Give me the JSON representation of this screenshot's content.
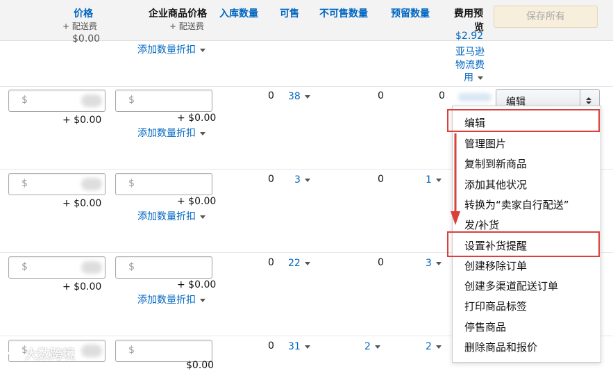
{
  "header": {
    "price_label": "价格",
    "price_sub": "+ 配送费",
    "business_price_label": "企业商品价格",
    "business_price_sub": "+ 配送费",
    "inbound_label": "入库数量",
    "available_label": "可售",
    "unsellable_label": "不可售数量",
    "reserved_label": "预留数量",
    "fee_preview_line1": "费用预",
    "fee_preview_line2": "览",
    "save_all": "保存所有"
  },
  "top_partial": {
    "partial_price": "$0.00",
    "add_discount": "添加数量折扣",
    "fee_line0": "$2.92",
    "fee_line1": "亚马逊",
    "fee_line2": "物流费",
    "fee_line3": "用"
  },
  "rows": [
    {
      "price_prefix": "$",
      "price_plus": "+ $0.00",
      "business_prefix": "$",
      "business_plus": "+ $0.00",
      "add_discount": "添加数量折扣",
      "inbound": "0",
      "available": "38",
      "unsellable": "0",
      "reserved": "0"
    },
    {
      "price_prefix": "$",
      "price_plus": "+ $0.00",
      "business_prefix": "$",
      "business_plus": "+ $0.00",
      "add_discount": "添加数量折扣",
      "inbound": "0",
      "available": "3",
      "unsellable": "0",
      "reserved": "1"
    },
    {
      "price_prefix": "$",
      "price_plus": "+ $0.00",
      "business_prefix": "$",
      "business_plus": "+ $0.00",
      "add_discount": "添加数量折扣",
      "inbound": "0",
      "available": "22",
      "unsellable": "0",
      "reserved": "3"
    },
    {
      "price_prefix": "$",
      "price_plus": "",
      "business_prefix": "$",
      "business_plus": "$0.00",
      "add_discount": "",
      "inbound": "0",
      "available": "31",
      "unsellable": "2",
      "reserved": "2"
    }
  ],
  "edit_select": {
    "label": "编辑"
  },
  "menu": {
    "items": [
      "编辑",
      "管理图片",
      "复制到新商品",
      "添加其他状况",
      "转换为“卖家自行配送”",
      "发/补货",
      "设置补货提醒",
      "创建移除订单",
      "创建多渠道配送订单",
      "打印商品标签",
      "停售商品",
      "删除商品和报价"
    ]
  },
  "watermark": "大数跨境",
  "colors": {
    "link": "#0066c0",
    "highlight": "#d9403a",
    "arrow": "#d9403a"
  }
}
